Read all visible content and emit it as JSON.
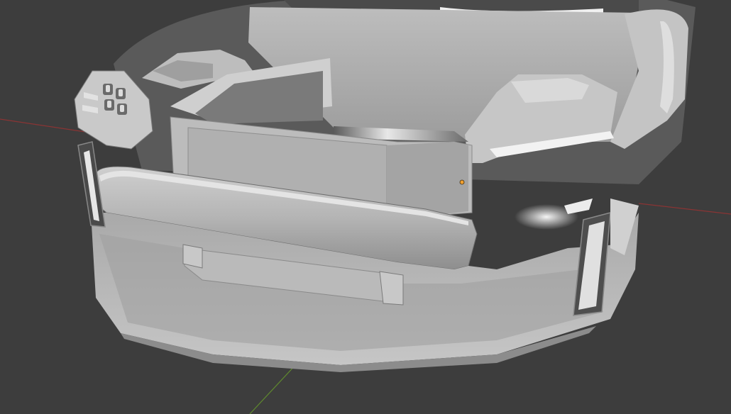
{
  "viewport": {
    "background_color": "#3d3d3d",
    "grid": {
      "x_axis_color": "#9a3a3a",
      "y_axis_color": "#5f8a2e",
      "shown": true
    },
    "object_origin": {
      "color": "#f0a030",
      "icon": "origin-dot-icon"
    },
    "model": {
      "shading": "solid",
      "base_color": "#a6a6a6",
      "highlight_color": "#ededed",
      "shadow_color": "#6e6e6e"
    }
  }
}
